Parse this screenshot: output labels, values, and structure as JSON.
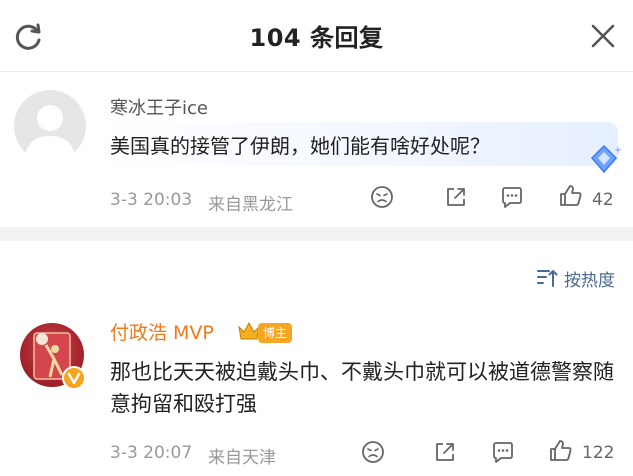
{
  "header": {
    "title": "104 条回复",
    "refresh_icon": "refresh-icon",
    "close_icon": "close-icon"
  },
  "post": {
    "username": "寒冰王子ice",
    "text": "美国真的接管了伊朗，她们能有啥好处呢？",
    "timestamp": "3-3 20:03",
    "location": "来自黑龙江",
    "like_count": "42"
  },
  "sort": {
    "label": "按热度"
  },
  "reply": {
    "username": "付政浩 MVP",
    "badge": "博主",
    "text": "那也比天天被迫戴头巾、不戴头巾就可以被道德警察随意拘留和殴打强",
    "timestamp": "3-3 20:07",
    "location": "来自天津",
    "like_count": "122"
  },
  "colors": {
    "username_highlight": "#f07a1a",
    "sort_link": "#4a6994",
    "meta_text": "#999999"
  }
}
